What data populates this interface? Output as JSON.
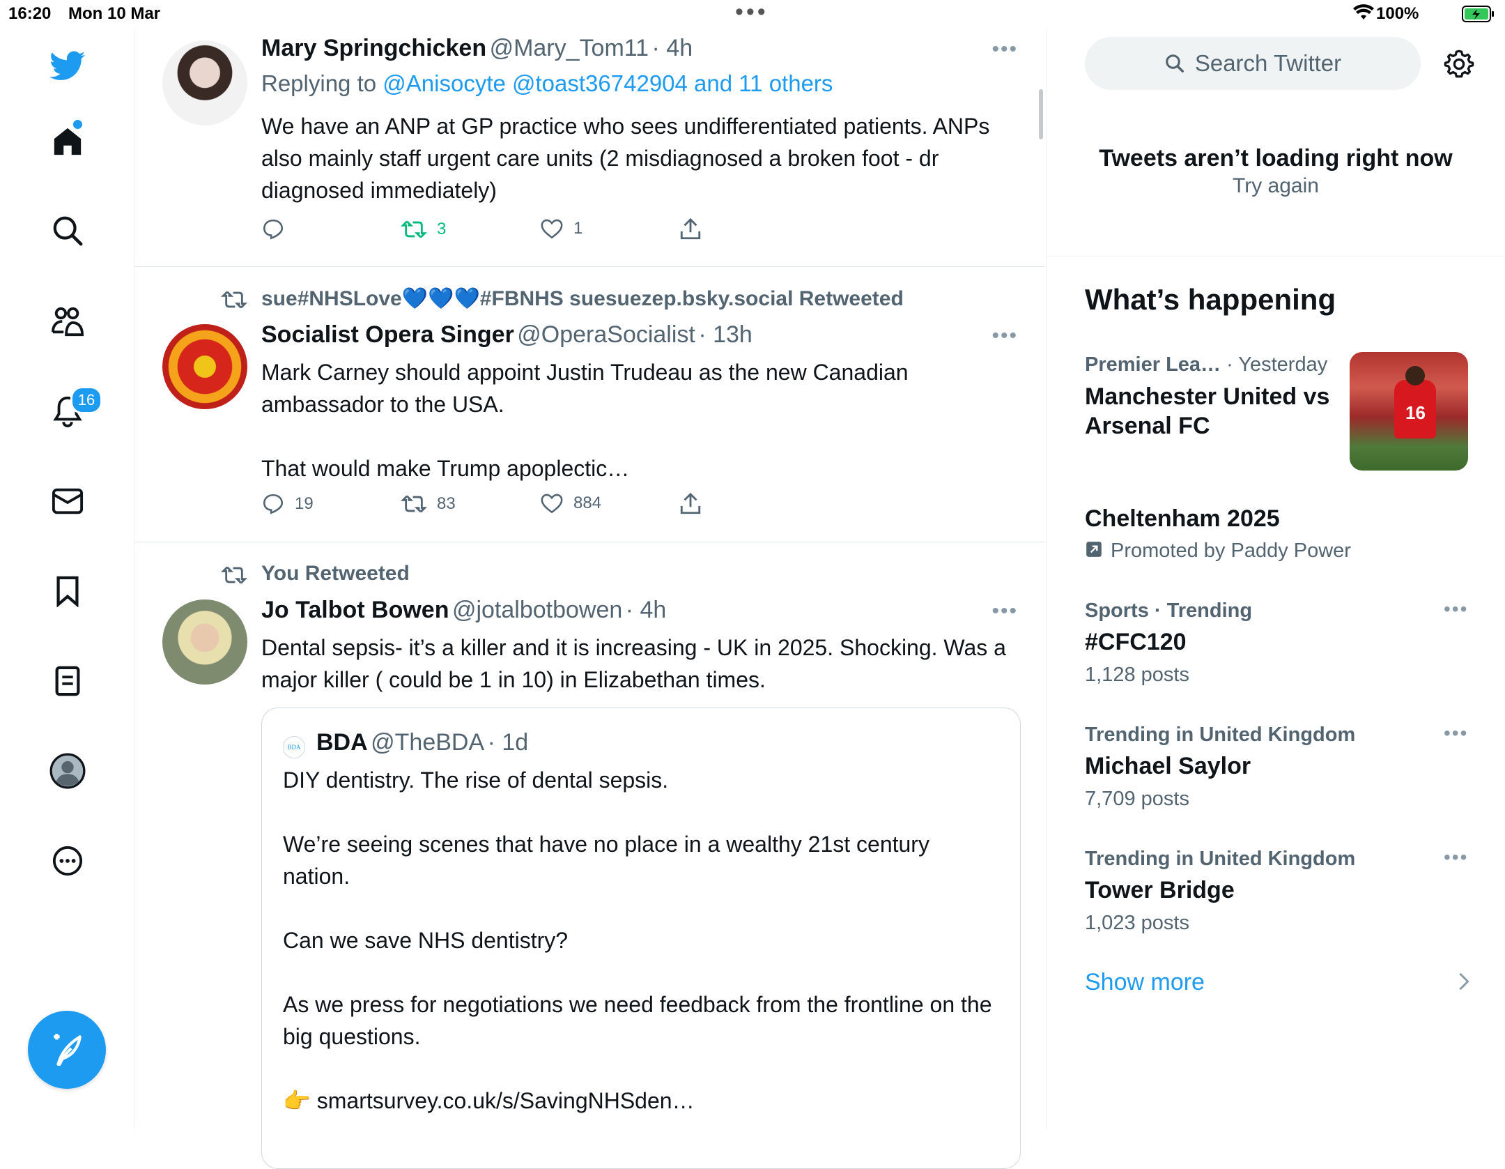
{
  "status_bar": {
    "time": "16:20",
    "date": "Mon 10 Mar",
    "battery": "100%"
  },
  "sidebar": {
    "notifications_count": "16"
  },
  "tweets": [
    {
      "name": "Mary Springchicken",
      "handle": "@Mary_Tom11",
      "time": "· 4h",
      "replying_prefix": "Replying to",
      "replying_to": "@Anisocyte @toast36742904 and 11 others",
      "text": "We have an ANP at GP practice who sees undifferentiated patients. ANPs also mainly staff urgent care units (2 misdiagnosed a broken foot - dr diagnosed immediately)",
      "replies": "",
      "retweets": "3",
      "likes": "1"
    },
    {
      "retweeted_by": "sue#NHSLove💙💙💙#FBNHS suesuezep.bsky.social Retweeted",
      "name": "Socialist Opera Singer",
      "handle": "@OperaSocialist",
      "time": "· 13h",
      "text": "Mark Carney should appoint Justin Trudeau as the new Canadian ambassador to the USA.\n\nThat would make Trump apoplectic…",
      "replies": "19",
      "retweets": "83",
      "likes": "884"
    },
    {
      "retweeted_by": "You Retweeted",
      "name": "Jo Talbot Bowen",
      "handle": "@jotalbotbowen",
      "time": "· 4h",
      "text": "Dental sepsis- it’s a killer and it is increasing - UK in 2025. Shocking. Was a major killer ( could be 1 in 10) in Elizabethan times.",
      "quote": {
        "logo_text": "BDA",
        "name": "BDA",
        "handle": "@TheBDA",
        "time": "· 1d",
        "text": "DIY dentistry. The rise of dental sepsis.\n\nWe’re seeing scenes that have no place in a wealthy 21st century nation.\n\nCan we save NHS dentistry?\n\nAs we press for negotiations we need feedback from the frontline on the big questions.\n\n👉 smartsurvey.co.uk/s/SavingNHSden…"
      }
    }
  ],
  "right": {
    "search_placeholder": "Search Twitter",
    "error_title": "Tweets aren’t loading right now",
    "error_retry": "Try again",
    "whats_happening": "What’s happening",
    "trends": [
      {
        "category": "Premier Lea…",
        "time": "· Yesterday",
        "title": "Manchester United vs Arsenal FC",
        "shirt_number": "16"
      },
      {
        "title": "Cheltenham 2025",
        "promoted": "Promoted by Paddy Power"
      },
      {
        "category": "Sports · Trending",
        "title": "#CFC120",
        "posts": "1,128 posts"
      },
      {
        "category": "Trending in United Kingdom",
        "title": "Michael Saylor",
        "posts": "7,709 posts"
      },
      {
        "category": "Trending in United Kingdom",
        "title": "Tower Bridge",
        "posts": "1,023 posts"
      }
    ],
    "show_more": "Show more"
  },
  "colors": {
    "accent": "#1d9bf0",
    "retweet_green": "#00ba7c",
    "muted": "#536471"
  },
  "icons": [
    "twitter-logo-icon",
    "home-icon",
    "search-icon",
    "communities-icon",
    "bell-icon",
    "mail-icon",
    "bookmark-icon",
    "lists-icon",
    "profile-icon",
    "more-circle-icon",
    "compose-icon",
    "reply-icon",
    "retweet-icon",
    "like-icon",
    "share-icon",
    "gear-icon",
    "chevron-right-icon",
    "promoted-icon"
  ]
}
